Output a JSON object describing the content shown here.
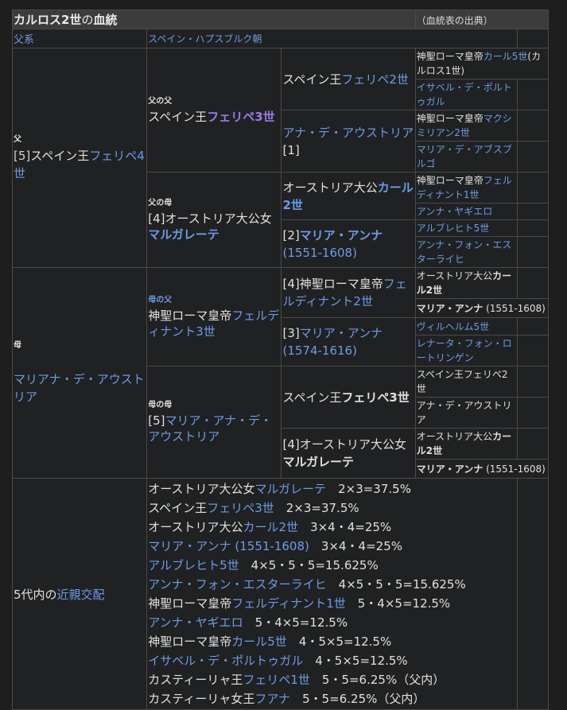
{
  "header": {
    "title_bold": "カルロス2世",
    "title_no": "の",
    "title_link": "血統",
    "source": "（血統表の出典）"
  },
  "lineage": {
    "label": "父系",
    "value": "スペイン・ハプスブルク朝"
  },
  "father": {
    "rel": "父",
    "num": "[5]",
    "pre": "スペイン王",
    "link": "フェリペ4世"
  },
  "ff": {
    "rel": "父の父",
    "pre": "スペイン王",
    "link": "フェリペ3世"
  },
  "fm": {
    "rel": "父の母",
    "num": "[4]",
    "pre": "オーストリア大公女",
    "bold": "マルガレーテ"
  },
  "mother": {
    "rel": "母",
    "link": "マリアナ・デ・アウストリア"
  },
  "mf": {
    "rel": "母の父",
    "pre": "神聖ローマ皇帝",
    "link": "フェルディナント3世"
  },
  "mm": {
    "rel": "母の母",
    "num": "[5]",
    "link": "マリア・アナ・デ・アウストリア"
  },
  "g3": {
    "fff": {
      "pre": "スペイン王",
      "link": "フェリペ2世"
    },
    "ffm": {
      "link": "アナ・デ・アウストリア",
      "num": "[1]"
    },
    "fmf": {
      "pre": "オーストリア大公",
      "bold": "カール2世"
    },
    "fmm": {
      "num": "[2]",
      "bold": "マリア・アンナ",
      "years": "(1551-1608)"
    },
    "mff": {
      "num": "[4]",
      "pre": "神聖ローマ皇帝",
      "link": "フェルディナント2世"
    },
    "mfm": {
      "num": "[3]",
      "link": "マリア・アンナ",
      "years": "(1574-1616)"
    },
    "mmf": {
      "pre": "スペイン王",
      "bold": "フェリペ3世"
    },
    "mmm": {
      "num": "[4]",
      "pre": "オーストリア大公女",
      "bold": "マルガレーテ"
    }
  },
  "g4": {
    "r1": {
      "pre": "神聖ローマ皇帝",
      "link": "カール5世",
      "post": "(カルロス1世)"
    },
    "r2": {
      "link": "イサベル・デ・ポルトゥガル"
    },
    "r3": {
      "pre": "神聖ローマ皇帝",
      "link": "マクシミリアン2世"
    },
    "r4": {
      "link": "マリア・デ・アブスブルゴ"
    },
    "r5": {
      "pre": "神聖ローマ皇帝",
      "link": "フェルディナント1世"
    },
    "r6": {
      "link": "アンナ・ヤギエロ"
    },
    "r7": {
      "link": "アルブレヒト5世"
    },
    "r8": {
      "link": "アンナ・フォン・エスターライヒ"
    },
    "r9": {
      "pre": "オーストリア大公",
      "bold": "カール2世"
    },
    "r10": {
      "bold": "マリア・アンナ",
      "years": "(1551-1608)"
    },
    "r11": {
      "link": "ヴィルヘルム5世"
    },
    "r12": {
      "link": "レナータ・フォン・ロートリンゲン"
    },
    "r13": {
      "text": "スペイン王フェリペ2世"
    },
    "r14": {
      "text": "アナ・デ・アウストリア"
    },
    "r15": {
      "pre": "オーストリア大公",
      "bold": "カール2世"
    },
    "r16": {
      "bold": "マリア・アンナ",
      "years": "(1551-1608)"
    }
  },
  "inbreeding": {
    "label_pre": "5代内の",
    "label_link": "近親交配",
    "items": [
      {
        "pre": "オーストリア大公女",
        "link": "マルガレーテ",
        "value": "2×3=37.5%"
      },
      {
        "pre": "スペイン王",
        "link": "フェリペ3世",
        "value": "2×3=37.5%"
      },
      {
        "pre": "オーストリア大公",
        "link": "カール2世",
        "value": "3×4・4=25%"
      },
      {
        "pre": "",
        "link": "マリア・アンナ (1551-1608)",
        "value": "3×4・4=25%"
      },
      {
        "pre": "",
        "link": "アルブレヒト5世",
        "value": "4×5・5・5=15.625%"
      },
      {
        "pre": "",
        "link": "アンナ・フォン・エスターライヒ",
        "value": "4×5・5・5=15.625%"
      },
      {
        "pre": "神聖ローマ皇帝",
        "link": "フェルディナント1世",
        "value": "5・4×5=12.5%"
      },
      {
        "pre": "",
        "link": "アンナ・ヤギエロ",
        "value": "5・4×5=12.5%"
      },
      {
        "pre": "神聖ローマ皇帝",
        "link": "カール5世",
        "value": "4・5×5=12.5%"
      },
      {
        "pre": "",
        "link": "イサベル・デ・ポルトゥガル",
        "value": "4・5×5=12.5%"
      },
      {
        "pre": "カスティーリャ王",
        "link": "フェリペ1世",
        "value": "5・5=6.25%（父内）"
      },
      {
        "pre": "カスティーリャ女王",
        "link": "フアナ",
        "value": "5・5=6.25%（父内）"
      }
    ]
  }
}
